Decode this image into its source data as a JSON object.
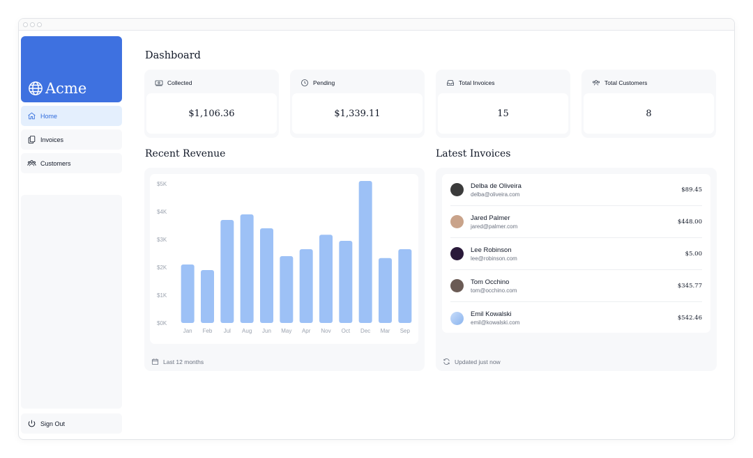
{
  "app": {
    "name": "Acme"
  },
  "sidebar": {
    "items": [
      {
        "label": "Home",
        "icon": "home-icon",
        "active": true
      },
      {
        "label": "Invoices",
        "icon": "document-duplicate-icon",
        "active": false
      },
      {
        "label": "Customers",
        "icon": "user-group-icon",
        "active": false
      }
    ],
    "sign_out": "Sign Out"
  },
  "page": {
    "title": "Dashboard"
  },
  "cards": [
    {
      "label": "Collected",
      "value": "$1,106.36",
      "icon": "banknotes-icon"
    },
    {
      "label": "Pending",
      "value": "$1,339.11",
      "icon": "clock-icon"
    },
    {
      "label": "Total Invoices",
      "value": "15",
      "icon": "inbox-icon"
    },
    {
      "label": "Total Customers",
      "value": "8",
      "icon": "user-group-icon"
    }
  ],
  "revenue": {
    "title": "Recent Revenue",
    "footer": "Last 12 months"
  },
  "latest": {
    "title": "Latest Invoices",
    "footer": "Updated just now",
    "items": [
      {
        "name": "Delba de Oliveira",
        "email": "delba@oliveira.com",
        "amount": "$89.45",
        "avatar_color": "#3b3b3b"
      },
      {
        "name": "Jared Palmer",
        "email": "jared@palmer.com",
        "amount": "$448.00",
        "avatar_color": "#c9a38a"
      },
      {
        "name": "Lee Robinson",
        "email": "lee@robinson.com",
        "amount": "$5.00",
        "avatar_color": "#2a1a3a"
      },
      {
        "name": "Tom Occhino",
        "email": "tom@occhino.com",
        "amount": "$345.77",
        "avatar_color": "#6b5b55"
      },
      {
        "name": "Emil Kowalski",
        "email": "emil@kowalski.com",
        "amount": "$542.46",
        "avatar_color": "#a7c7f2"
      }
    ]
  },
  "chart_data": {
    "type": "bar",
    "categories": [
      "Jan",
      "Feb",
      "Jul",
      "Aug",
      "Jun",
      "May",
      "Apr",
      "Nov",
      "Oct",
      "Dec",
      "Mar",
      "Sep"
    ],
    "values": [
      2100,
      1900,
      3700,
      3900,
      3400,
      2400,
      2650,
      3170,
      2950,
      5100,
      2330,
      2650
    ],
    "ylim": [
      0,
      5000
    ],
    "yticks": [
      "$5K",
      "$4K",
      "$3K",
      "$2K",
      "$1K",
      "$0K"
    ],
    "bar_color": "#9dc1f6",
    "grid": false
  }
}
